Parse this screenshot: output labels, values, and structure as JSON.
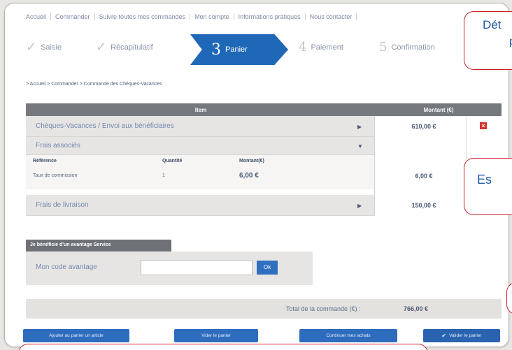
{
  "topnav": [
    "Accueil",
    "Commander",
    "Suivre toutes mes commandes",
    "Mon compte",
    "Informations pratiques",
    "Nous contacter"
  ],
  "steps": [
    {
      "num": "",
      "label": "Saisie"
    },
    {
      "num": "",
      "label": "Récapitulatif"
    },
    {
      "num": "3",
      "label": "Panier"
    },
    {
      "num": "4",
      "label": "Paiement"
    },
    {
      "num": "5",
      "label": "Confirmation"
    }
  ],
  "breadcrumb": "> Accueil > Commander > Commande des Chèques-Vacances",
  "table": {
    "header_item": "Item",
    "header_amount": "Montant (€)",
    "rows": [
      {
        "label": "Chèques-Vacances / Envoi aux bénéficiaires",
        "amount": "610,00 €"
      },
      {
        "label": "Frais associés",
        "amount": "6,00 €"
      },
      {
        "label": "Frais de livraison",
        "amount": "150,00 €"
      }
    ],
    "subtable": {
      "headers": [
        "Référence",
        "Quantité",
        "Montant(€)"
      ],
      "row": [
        "Taux de commission",
        "1",
        "6,00 €"
      ]
    },
    "delete_icon": "close-icon"
  },
  "avantage": {
    "title": "Je bénéficie d'un avantage Service",
    "label": "Mon code avantage",
    "ok": "Ok"
  },
  "total": {
    "label": "Total de la commande (€) :",
    "value": "766,00 €"
  },
  "buttons": [
    "Ajouter au panier un article",
    "Vider le panier",
    "Continuer mes achats",
    "Valider le panier"
  ],
  "callouts": {
    "top": {
      "line1": "Dét",
      "line2": "p"
    },
    "middle": {
      "line1": "Es"
    }
  },
  "colors": {
    "accent": "#1f67b7",
    "callout_border": "#cc1f2d"
  }
}
